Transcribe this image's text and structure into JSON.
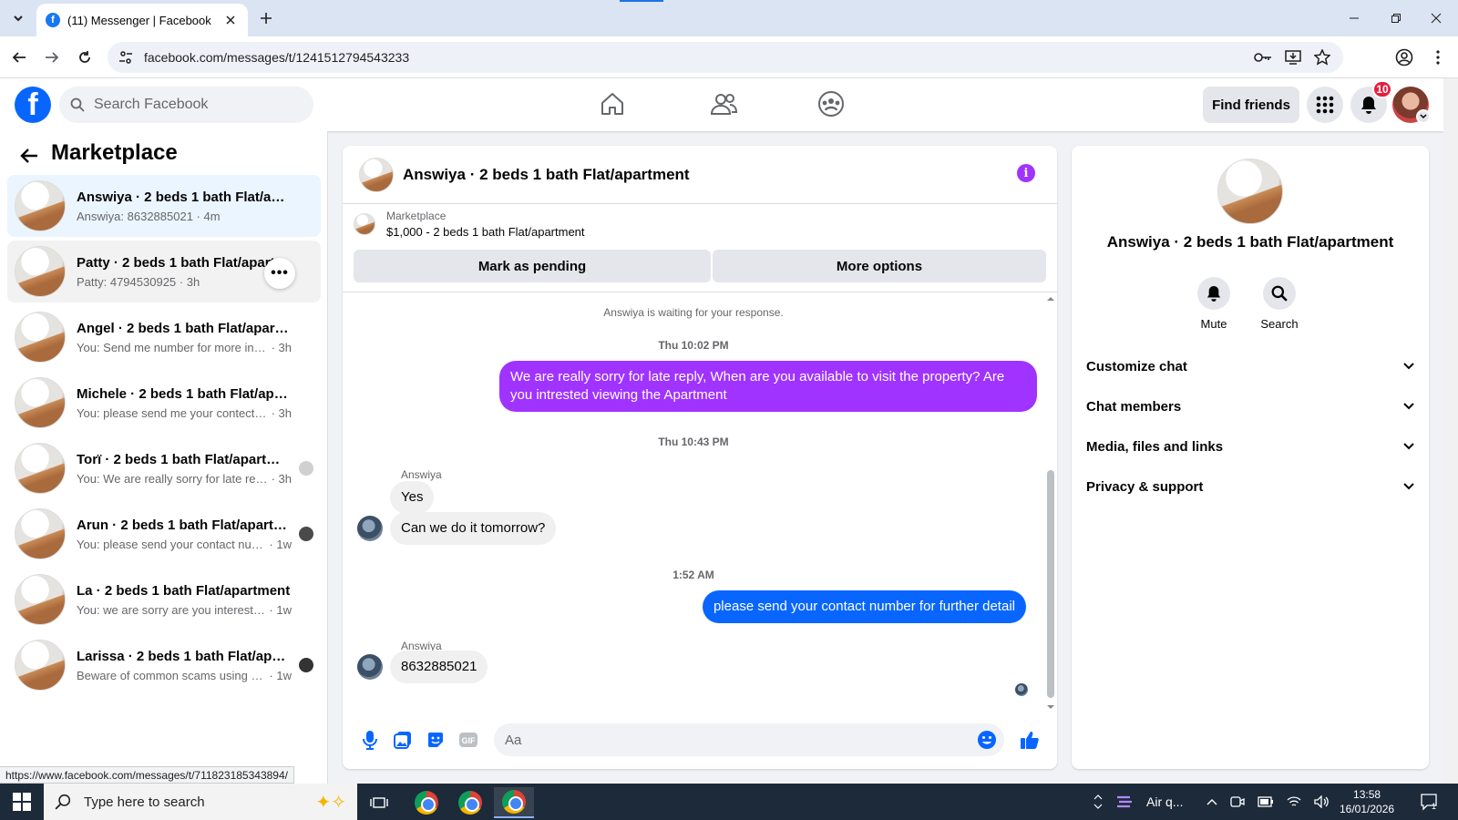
{
  "browser": {
    "tab_title": "(11) Messenger | Facebook",
    "url": "facebook.com/messages/t/1241512794543233",
    "status_url": "https://www.facebook.com/messages/t/711823185343894/"
  },
  "header": {
    "search_placeholder": "Search Facebook",
    "find_friends": "Find friends",
    "notification_count": "10"
  },
  "sidebar": {
    "title": "Marketplace",
    "conversations": [
      {
        "name": "Answiya · 2 beds 1 bath Flat/apart...",
        "preview": "Answiya: 8632885021",
        "time": "4m"
      },
      {
        "name": "Patty · 2 beds 1 bath Flat/apartment",
        "preview": "Patty: 4794530925",
        "time": "3h"
      },
      {
        "name": "Angel · 2 beds 1 bath Flat/apartme...",
        "preview": "You: Send me number for more infor...",
        "time": "3h"
      },
      {
        "name": "Michele · 2 beds 1 bath Flat/apart...",
        "preview": "You: please send me your contect nu...",
        "time": "3h"
      },
      {
        "name": "Torï · 2 beds 1 bath Flat/apartme...",
        "preview": "You: We are really sorry for late rep...",
        "time": "3h"
      },
      {
        "name": "Arun · 2 beds 1 bath Flat/apartm...",
        "preview": "You: please send your contact num...",
        "time": "1w"
      },
      {
        "name": "La · 2 beds 1 bath Flat/apartment",
        "preview": "You: we are sorry are you interested n...",
        "time": "1w"
      },
      {
        "name": "Larissa · 2 beds 1 bath Flat/apart...",
        "preview": "Beware of common scams using p...",
        "time": "1w"
      }
    ]
  },
  "chat": {
    "title": "Answiya · 2 beds 1 bath Flat/apartment",
    "listing_label": "Marketplace",
    "listing_detail": "$1,000 - 2 beds 1 bath Flat/apartment",
    "btn_pending": "Mark as pending",
    "btn_more": "More options",
    "waiting": "Answiya is waiting for your response.",
    "ts1": "Thu 10:02 PM",
    "msg1": "We are really sorry for late reply, When are you available to visit the property? Are you intrested viewing the Apartment",
    "ts2": "Thu 10:43 PM",
    "sender": "Answiya",
    "msg2": "Yes",
    "msg3": "Can we do it tomorrow?",
    "ts3": "1:52 AM",
    "msg4": "please send your contact number for further detail",
    "msg5": "8632885021",
    "input_placeholder": "Aa"
  },
  "info": {
    "name": "Answiya · 2 beds 1 bath Flat/apartment",
    "mute": "Mute",
    "search": "Search",
    "sections": [
      "Customize chat",
      "Chat members",
      "Media, files and links",
      "Privacy & support"
    ]
  },
  "taskbar": {
    "search_placeholder": "Type here to search",
    "weather": "Air q...",
    "time": "13:58",
    "date": "16/01/2026",
    "notif_count": "1"
  },
  "colors": {
    "fb_blue": "#0866ff",
    "purple_bubble": "#a033ff",
    "badge_red": "#e41e3f"
  }
}
